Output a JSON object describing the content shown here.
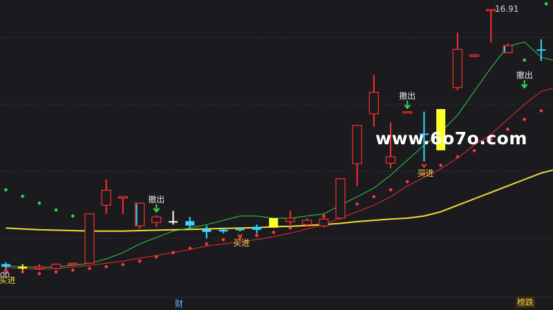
{
  "chart_data": {
    "type": "candlestick",
    "price_label": "16.91",
    "watermark": "www.6o7o.com",
    "left_edge_text": "00",
    "candles": [
      {
        "o": 10.92,
        "c": 10.98,
        "h": 11.02,
        "l": 10.88,
        "color": "cyan"
      },
      {
        "o": 10.92,
        "c": 10.88,
        "h": 10.98,
        "l": 10.84,
        "color": "yellow"
      },
      {
        "o": 10.88,
        "c": 10.92,
        "h": 10.98,
        "l": 10.84,
        "color": "red"
      },
      {
        "o": 10.88,
        "c": 10.98,
        "h": 11.0,
        "l": 10.86,
        "color": "red"
      },
      {
        "o": 10.98,
        "c": 11.0,
        "h": 11.02,
        "l": 10.96,
        "color": "red"
      },
      {
        "o": 11.0,
        "c": 12.15,
        "h": 12.15,
        "l": 10.98,
        "color": "red"
      },
      {
        "o": 12.35,
        "c": 12.7,
        "h": 12.95,
        "l": 12.15,
        "color": "red"
      },
      {
        "o": 12.55,
        "c": 12.55,
        "h": 12.55,
        "l": 12.15,
        "color": "red"
      },
      {
        "o": 12.4,
        "c": 11.87,
        "h": 12.4,
        "l": 11.8,
        "color": "cyan_hollow"
      },
      {
        "o": 11.95,
        "c": 12.08,
        "h": 12.12,
        "l": 11.85,
        "color": "red"
      },
      {
        "o": 11.98,
        "c": 11.98,
        "h": 12.22,
        "l": 11.9,
        "color": "white"
      },
      {
        "o": 11.98,
        "c": 11.88,
        "h": 12.08,
        "l": 11.82,
        "color": "cyan"
      },
      {
        "o": 11.79,
        "c": 11.73,
        "h": 11.88,
        "l": 11.58,
        "color": "cyan"
      },
      {
        "o": 11.78,
        "c": 11.74,
        "h": 11.83,
        "l": 11.7,
        "color": "cyan"
      },
      {
        "o": 11.8,
        "c": 11.78,
        "h": 11.83,
        "l": 11.74,
        "color": "cyan"
      },
      {
        "o": 11.85,
        "c": 11.78,
        "h": 11.9,
        "l": 11.7,
        "color": "cyan"
      },
      {
        "o": 12.05,
        "c": 11.83,
        "h": 12.05,
        "l": 11.83,
        "color": "yellow"
      },
      {
        "o": 11.97,
        "c": 12.05,
        "h": 12.22,
        "l": 11.9,
        "color": "red"
      },
      {
        "o": 12.0,
        "c": 11.9,
        "h": 12.05,
        "l": 11.85,
        "color": "red"
      },
      {
        "o": 11.87,
        "c": 12.03,
        "h": 12.1,
        "l": 11.84,
        "color": "red"
      },
      {
        "o": 12.05,
        "c": 12.97,
        "h": 12.97,
        "l": 12.02,
        "color": "red"
      },
      {
        "o": 13.32,
        "c": 14.21,
        "h": 14.21,
        "l": 12.8,
        "color": "red"
      },
      {
        "o": 14.48,
        "c": 14.98,
        "h": 15.39,
        "l": 14.18,
        "color": "red"
      },
      {
        "o": 13.33,
        "c": 13.48,
        "h": 14.28,
        "l": 13.21,
        "color": "red"
      },
      {
        "o": 14.53,
        "c": 14.53,
        "h": 14.53,
        "l": 14.53,
        "color": "red"
      },
      {
        "o": 14.02,
        "c": 14.02,
        "h": 14.53,
        "l": 13.37,
        "color": "cyan"
      },
      {
        "o": 14.59,
        "c": 13.63,
        "h": 14.59,
        "l": 13.63,
        "color": "yellow"
      },
      {
        "o": 15.09,
        "c": 15.98,
        "h": 16.37,
        "l": 15.03,
        "color": "red"
      },
      {
        "o": 15.85,
        "c": 15.85,
        "h": 15.85,
        "l": 15.82,
        "color": "red"
      },
      {
        "o": 16.91,
        "c": 16.91,
        "h": 16.91,
        "l": 16.14,
        "color": "red"
      },
      {
        "o": 16.07,
        "c": 15.9,
        "h": 16.12,
        "l": 15.9,
        "color": "cyan_hollow"
      },
      {
        "o": null,
        "c": null,
        "h": null,
        "l": null,
        "color": "none"
      },
      {
        "o": 15.98,
        "c": 15.98,
        "h": 16.21,
        "l": 15.71,
        "color": "cyan"
      },
      {
        "o": 14.5,
        "c": 14.4,
        "h": 14.55,
        "l": 14.4,
        "color": "cyan"
      }
    ],
    "red_dots": [
      10.84,
      10.8,
      10.76,
      10.8,
      10.84,
      10.88,
      10.92,
      10.97,
      11.05,
      11.15,
      11.25,
      11.35,
      11.45,
      11.55,
      11.6,
      11.65,
      11.72,
      11.82,
      11.96,
      12.1,
      12.24,
      12.38,
      12.55,
      12.71,
      12.9,
      13.09,
      13.28,
      13.48,
      13.62,
      13.88,
      14.12,
      14.35,
      14.55,
      14.7
    ],
    "green_dots": [
      12.71,
      12.56,
      12.4,
      12.24,
      12.1,
      11.98
    ],
    "green_dots_right": [
      15.73,
      17.04
    ],
    "ma_green": [
      10.94,
      10.92,
      10.9,
      10.92,
      10.95,
      11.0,
      11.1,
      11.25,
      11.45,
      11.6,
      11.75,
      11.82,
      11.9,
      12.0,
      12.1,
      12.1,
      12.05,
      12.05,
      12.1,
      12.15,
      12.35,
      12.55,
      12.75,
      13.05,
      13.4,
      13.75,
      14.05,
      14.45,
      15.0,
      15.55,
      16.05,
      16.15,
      15.8,
      15.7
    ],
    "ma_red": [
      10.9,
      10.88,
      10.86,
      10.88,
      10.91,
      10.95,
      11.0,
      11.05,
      11.12,
      11.18,
      11.25,
      11.32,
      11.4,
      11.45,
      11.5,
      11.55,
      11.62,
      11.7,
      11.8,
      11.9,
      12.05,
      12.2,
      12.35,
      12.55,
      12.8,
      13.0,
      13.2,
      13.45,
      13.75,
      14.0,
      14.35,
      14.7,
      15.0,
      15.1
    ],
    "ma_yellow": [
      11.82,
      11.8,
      11.78,
      11.77,
      11.76,
      11.75,
      11.75,
      11.75,
      11.76,
      11.77,
      11.78,
      11.79,
      11.8,
      11.81,
      11.82,
      11.83,
      11.85,
      11.86,
      11.88,
      11.9,
      11.93,
      11.97,
      12.0,
      12.03,
      12.05,
      12.1,
      12.2,
      12.35,
      12.5,
      12.65,
      12.8,
      12.95,
      13.1,
      13.2
    ],
    "markers": [
      {
        "type": "cancel",
        "candle": 9,
        "text": "撤出"
      },
      {
        "type": "buy",
        "candle": 0,
        "text": "买进"
      },
      {
        "type": "buy",
        "candle": 14,
        "text": "买进"
      },
      {
        "type": "cancel",
        "candle": 24,
        "text": "撤出"
      },
      {
        "type": "buy",
        "candle": 25,
        "text": "买进"
      },
      {
        "type": "cancel",
        "candle": 31,
        "text": "撤出"
      }
    ]
  },
  "bottom": {
    "left_label": "财",
    "right_label": "榜跌"
  }
}
